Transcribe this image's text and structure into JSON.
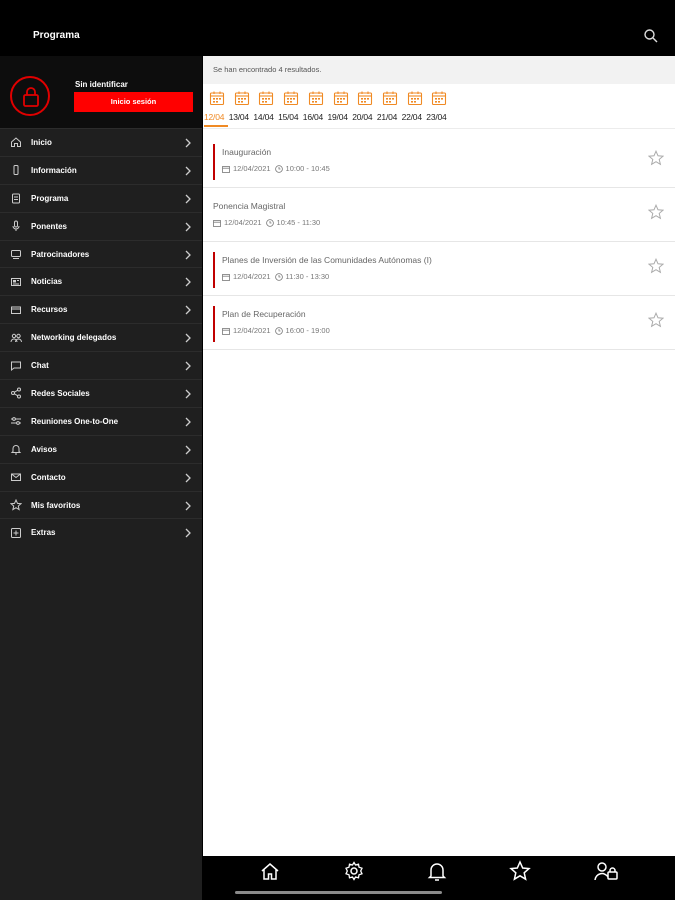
{
  "topbar": {
    "title": "Programa",
    "search_icon": "search-icon"
  },
  "profile": {
    "who": "Sin identificar",
    "login_label": "Inicio sesión",
    "lock_icon": "lock-icon"
  },
  "menu": [
    {
      "label": "Inicio",
      "icon": "home-icon"
    },
    {
      "label": "Información",
      "icon": "info-icon"
    },
    {
      "label": "Programa",
      "icon": "clipboard-icon"
    },
    {
      "label": "Ponentes",
      "icon": "microphone-icon"
    },
    {
      "label": "Patrocinadores",
      "icon": "sponsors-icon"
    },
    {
      "label": "Noticias",
      "icon": "newspaper-icon"
    },
    {
      "label": "Recursos",
      "icon": "resources-icon"
    },
    {
      "label": "Networking delegados",
      "icon": "people-icon"
    },
    {
      "label": "Chat",
      "icon": "chat-icon"
    },
    {
      "label": "Redes Sociales",
      "icon": "share-icon"
    },
    {
      "label": "Reuniones One-to-One",
      "icon": "meetings-icon"
    },
    {
      "label": "Avisos",
      "icon": "bell-icon"
    },
    {
      "label": "Contacto",
      "icon": "mail-icon"
    },
    {
      "label": "Mis favoritos",
      "icon": "star-icon"
    },
    {
      "label": "Extras",
      "icon": "plus-box-icon"
    }
  ],
  "content": {
    "results_text": "Se han encontrado 4 resultados.",
    "dates": [
      "12/04",
      "13/04",
      "14/04",
      "15/04",
      "16/04",
      "19/04",
      "20/04",
      "21/04",
      "22/04",
      "23/04"
    ],
    "active_date": "12/04",
    "events": [
      {
        "title": "Inauguración",
        "date": "12/04/2021",
        "time": "10:00 - 10:45",
        "marked": true
      },
      {
        "title": "Ponencia Magistral",
        "date": "12/04/2021",
        "time": "10:45 - 11:30",
        "marked": false
      },
      {
        "title": "Planes de Inversión de las Comunidades Autónomas (I)",
        "date": "12/04/2021",
        "time": "11:30 - 13:30",
        "marked": true
      },
      {
        "title": "Plan de Recuperación",
        "date": "12/04/2021",
        "time": "16:00 - 19:00",
        "marked": true
      }
    ]
  },
  "bottomnav": [
    "home-icon",
    "settings-icon",
    "bell-icon",
    "star-icon",
    "user-lock-icon"
  ],
  "colors": {
    "accent_red": "#ff0000",
    "date_orange": "#f08a24",
    "sidebar_bg": "#1f1f1f"
  }
}
